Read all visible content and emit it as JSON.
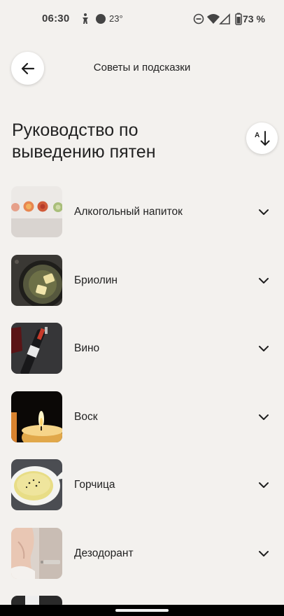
{
  "status_bar": {
    "time": "06:30",
    "temperature": "23°",
    "battery": "73 %",
    "icons": [
      "accessibility-icon",
      "circle-icon",
      "dnd-icon",
      "wifi-icon",
      "signal-icon",
      "battery-icon"
    ]
  },
  "header": {
    "title": "Советы и подсказки",
    "back_icon": "arrow-left-icon"
  },
  "page": {
    "title": "Руководство по выведению пятен",
    "sort_icon": "sort-alpha-down-icon",
    "sort_letter": "A"
  },
  "items": [
    {
      "label": "Алкогольный напиток",
      "icon": "chevron-down-icon"
    },
    {
      "label": "Бриолин",
      "icon": "chevron-down-icon"
    },
    {
      "label": "Вино",
      "icon": "chevron-down-icon"
    },
    {
      "label": "Воск",
      "icon": "chevron-down-icon"
    },
    {
      "label": "Горчица",
      "icon": "chevron-down-icon"
    },
    {
      "label": "Дезодорант",
      "icon": "chevron-down-icon"
    }
  ],
  "colors": {
    "background": "#f3f1ee",
    "surface": "#ffffff",
    "text": "#222222"
  }
}
